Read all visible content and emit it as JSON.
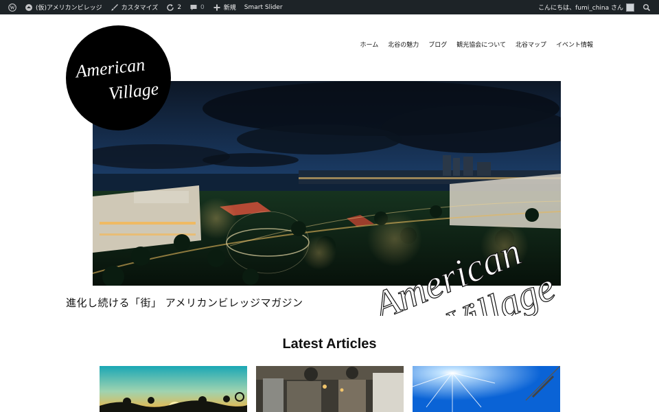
{
  "admin_bar": {
    "site_name": "(仮)アメリカンビレッジ",
    "customize": "カスタマイズ",
    "updates_count": "2",
    "comments_count": "0",
    "new_label": "新規",
    "smart_slider": "Smart Slider",
    "greeting": "こんにちは、fumi_china さん"
  },
  "nav": {
    "items": [
      "ホーム",
      "北谷の魅力",
      "ブログ",
      "観光協会について",
      "北谷マップ",
      "イベント情報"
    ]
  },
  "logo": {
    "line1": "American",
    "line2": "Village"
  },
  "hero": {
    "script_line1": "American",
    "script_line2": "Village"
  },
  "tagline": "進化し続ける「街」 アメリカンビレッジマガジン",
  "latest": {
    "title": "Latest Articles"
  },
  "colors": {
    "admin_bar_bg": "#1d2327",
    "page_bg": "#ffffff",
    "logo_bg": "#000000"
  }
}
